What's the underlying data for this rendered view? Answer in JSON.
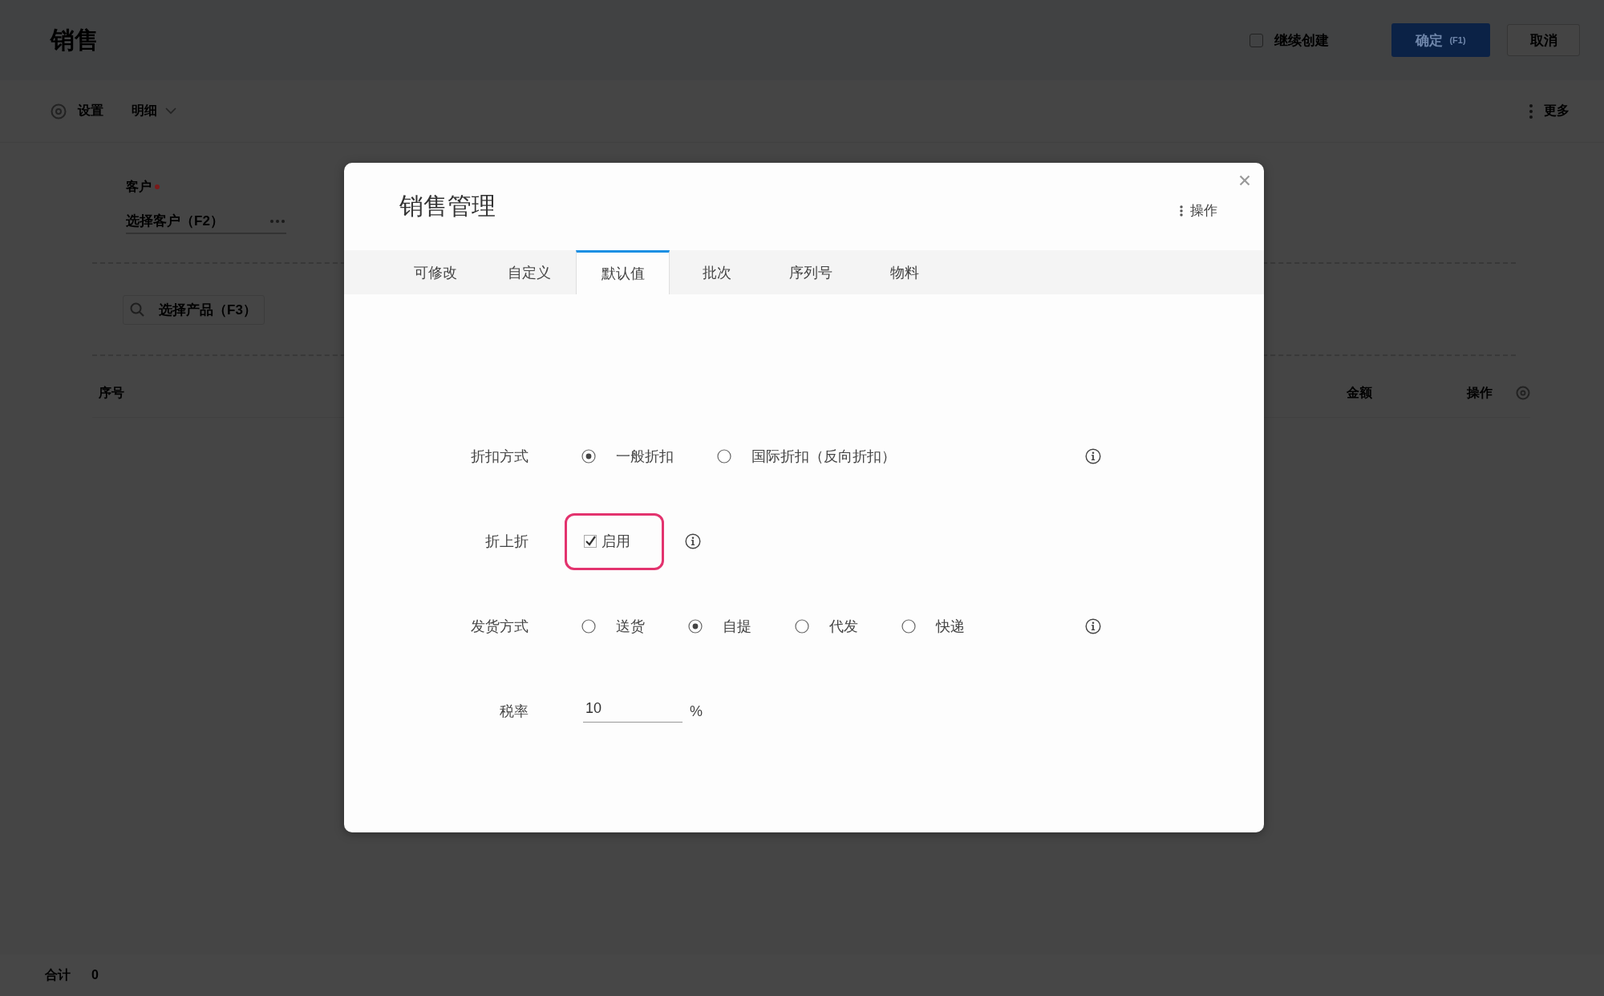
{
  "page": {
    "title": "销售",
    "continue_create": {
      "label": "继续创建",
      "checked": false
    },
    "actions": [
      {
        "kind": "primary",
        "label": "确定",
        "shortcut": "(F1)"
      },
      {
        "kind": "default",
        "label": "取消"
      }
    ],
    "toolbar": {
      "settings": "设置",
      "view": "明细",
      "more": "更多"
    },
    "customer_field": {
      "label": "客户",
      "required": true,
      "placeholder": "选择客户（F2）"
    },
    "product_search": {
      "placeholder": "选择产品（F3）"
    },
    "table": {
      "columns": [
        "序号",
        "金额",
        "操作"
      ]
    },
    "footer": {
      "label": "合计",
      "value": "0"
    }
  },
  "dialog": {
    "title": "销售管理",
    "menu": "操作",
    "tabs": [
      {
        "label": "可修改",
        "selected": false
      },
      {
        "label": "自定义",
        "selected": false
      },
      {
        "label": "默认值",
        "selected": true
      },
      {
        "label": "批次",
        "selected": false
      },
      {
        "label": "序列号",
        "selected": false
      },
      {
        "label": "物料",
        "selected": false
      }
    ],
    "fields": [
      {
        "kind": "radio",
        "label": "折扣方式",
        "info": true,
        "highlighted": false,
        "options": [
          {
            "label": "一般折扣",
            "selected": true
          },
          {
            "label": "国际折扣（反向折扣）",
            "selected": false
          }
        ]
      },
      {
        "kind": "checkbox",
        "label": "折上折",
        "info": true,
        "highlighted": true,
        "option": {
          "label": "启用",
          "checked": true
        }
      },
      {
        "kind": "radio",
        "label": "发货方式",
        "info": true,
        "highlighted": false,
        "options": [
          {
            "label": "送货",
            "selected": false
          },
          {
            "label": "自提",
            "selected": true
          },
          {
            "label": "代发",
            "selected": false
          },
          {
            "label": "快递",
            "selected": false
          }
        ]
      },
      {
        "kind": "input",
        "label": "税率",
        "info": false,
        "highlighted": false,
        "value": "10",
        "unit": "%"
      }
    ]
  }
}
